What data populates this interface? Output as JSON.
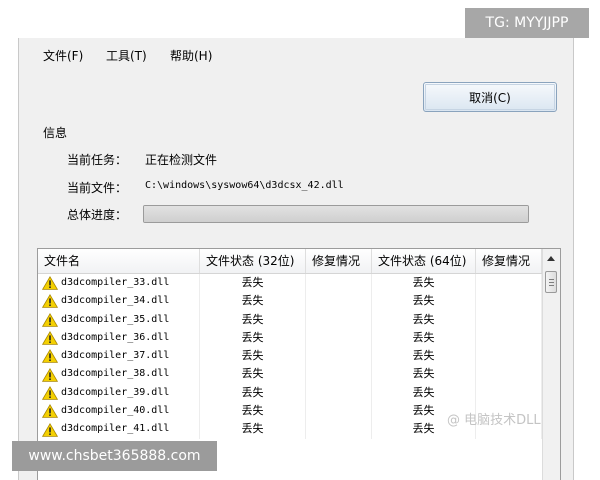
{
  "menu": {
    "file": "文件(F)",
    "tools": "工具(T)",
    "help": "帮助(H)"
  },
  "cancel_label": "取消(C)",
  "info": {
    "group_label": "信息",
    "task_label": "当前任务：",
    "task_value": "正在检测文件",
    "file_label": "当前文件：",
    "file_value": "C:\\windows\\syswow64\\d3dcsx_42.dll",
    "progress_label": "总体进度：",
    "progress_value": 1.0
  },
  "table": {
    "columns": [
      "文件名",
      "文件状态 (32位)",
      "修复情况",
      "文件状态 (64位)",
      "修复情况"
    ],
    "rows": [
      {
        "name": "d3dcompiler_33.dll",
        "status32": "丢失",
        "fix32": "",
        "status64": "丢失",
        "fix64": ""
      },
      {
        "name": "d3dcompiler_34.dll",
        "status32": "丢失",
        "fix32": "",
        "status64": "丢失",
        "fix64": ""
      },
      {
        "name": "d3dcompiler_35.dll",
        "status32": "丢失",
        "fix32": "",
        "status64": "丢失",
        "fix64": ""
      },
      {
        "name": "d3dcompiler_36.dll",
        "status32": "丢失",
        "fix32": "",
        "status64": "丢失",
        "fix64": ""
      },
      {
        "name": "d3dcompiler_37.dll",
        "status32": "丢失",
        "fix32": "",
        "status64": "丢失",
        "fix64": ""
      },
      {
        "name": "d3dcompiler_38.dll",
        "status32": "丢失",
        "fix32": "",
        "status64": "丢失",
        "fix64": ""
      },
      {
        "name": "d3dcompiler_39.dll",
        "status32": "丢失",
        "fix32": "",
        "status64": "丢失",
        "fix64": ""
      },
      {
        "name": "d3dcompiler_40.dll",
        "status32": "丢失",
        "fix32": "",
        "status64": "丢失",
        "fix64": ""
      },
      {
        "name": "d3dcompiler_41.dll",
        "status32": "丢失",
        "fix32": "",
        "status64": "丢失",
        "fix64": ""
      }
    ]
  },
  "overlays": {
    "tg_badge": "TG: MYYJJPP",
    "url": "www.chsbet365888.com",
    "watermark": "@ 电脑技术DLL"
  },
  "icons": {
    "row_status": "warning-icon",
    "scroll_up": "scroll-up-arrow-icon"
  },
  "colors": {
    "warning_fill": "#f4d000",
    "dialog_bg": "#f0f0f0"
  }
}
